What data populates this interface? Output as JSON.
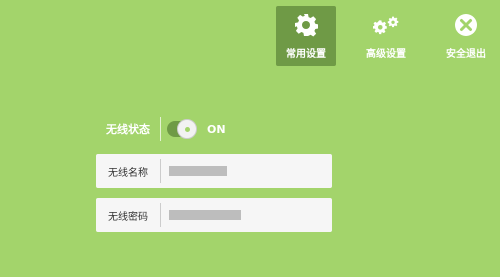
{
  "nav": {
    "common": {
      "label": "常用设置",
      "icon": "gear-icon"
    },
    "advanced": {
      "label": "高级设置",
      "icon": "gears-icon"
    },
    "logout": {
      "label": "安全退出",
      "icon": "close-circle-icon"
    }
  },
  "wireless": {
    "status_label": "无线状态",
    "status_value": "ON",
    "name_label": "无线名称",
    "password_label": "无线密码"
  },
  "colors": {
    "background": "#a3d46b",
    "active_nav": "#6f9a46",
    "field_bg": "#f6f6f6"
  }
}
